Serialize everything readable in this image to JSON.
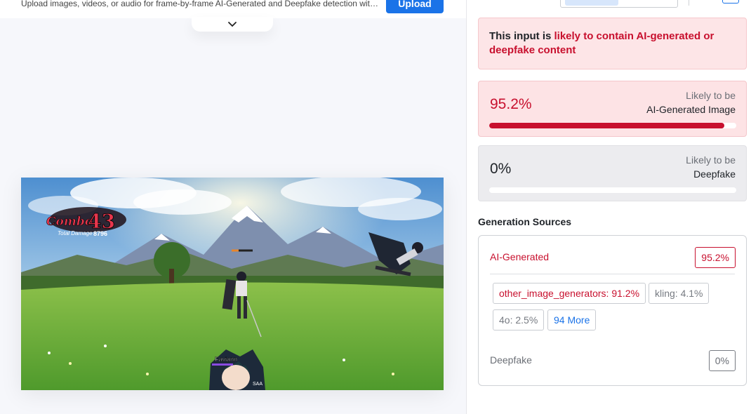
{
  "header": {
    "upload_description": "Upload images, videos, or audio for frame-by-frame AI-Generated and Deepfake detection with...",
    "upload_button": "Upload"
  },
  "icons": {
    "collapse": "chevron-down-icon"
  },
  "verdict": {
    "prefix": "This input is ",
    "highlight": "likely to contain AI-generated or deepfake content"
  },
  "scores": {
    "ai_generated": {
      "value": "95.2%",
      "fraction": 0.952,
      "label_top": "Likely to be",
      "label_main": "AI-Generated Image"
    },
    "deepfake": {
      "value": "0%",
      "fraction": 0.0,
      "label_top": "Likely to be",
      "label_main": "Deepfake"
    }
  },
  "generation_sources": {
    "title": "Generation Sources",
    "ai_generated_label": "AI-Generated",
    "ai_generated_value": "95.2%",
    "chips": [
      "other_image_generators: 91.2%",
      "kling: 4.1%",
      "4o: 2.5%"
    ],
    "more_label": "94 More",
    "deepfake_label": "Deepfake",
    "deepfake_value": "0%"
  },
  "game_hud": {
    "combo_label": "Combo",
    "combo_count": "43",
    "total_damage_label": "Total Damage",
    "total_damage_value": "8796",
    "player_name": "Faviann",
    "player_tag": "SAA"
  },
  "colors": {
    "accent_blue": "#1a73e8",
    "alert_red": "#c8102e",
    "alert_bg": "#fde5e7",
    "neutral_bg": "#ececef"
  }
}
